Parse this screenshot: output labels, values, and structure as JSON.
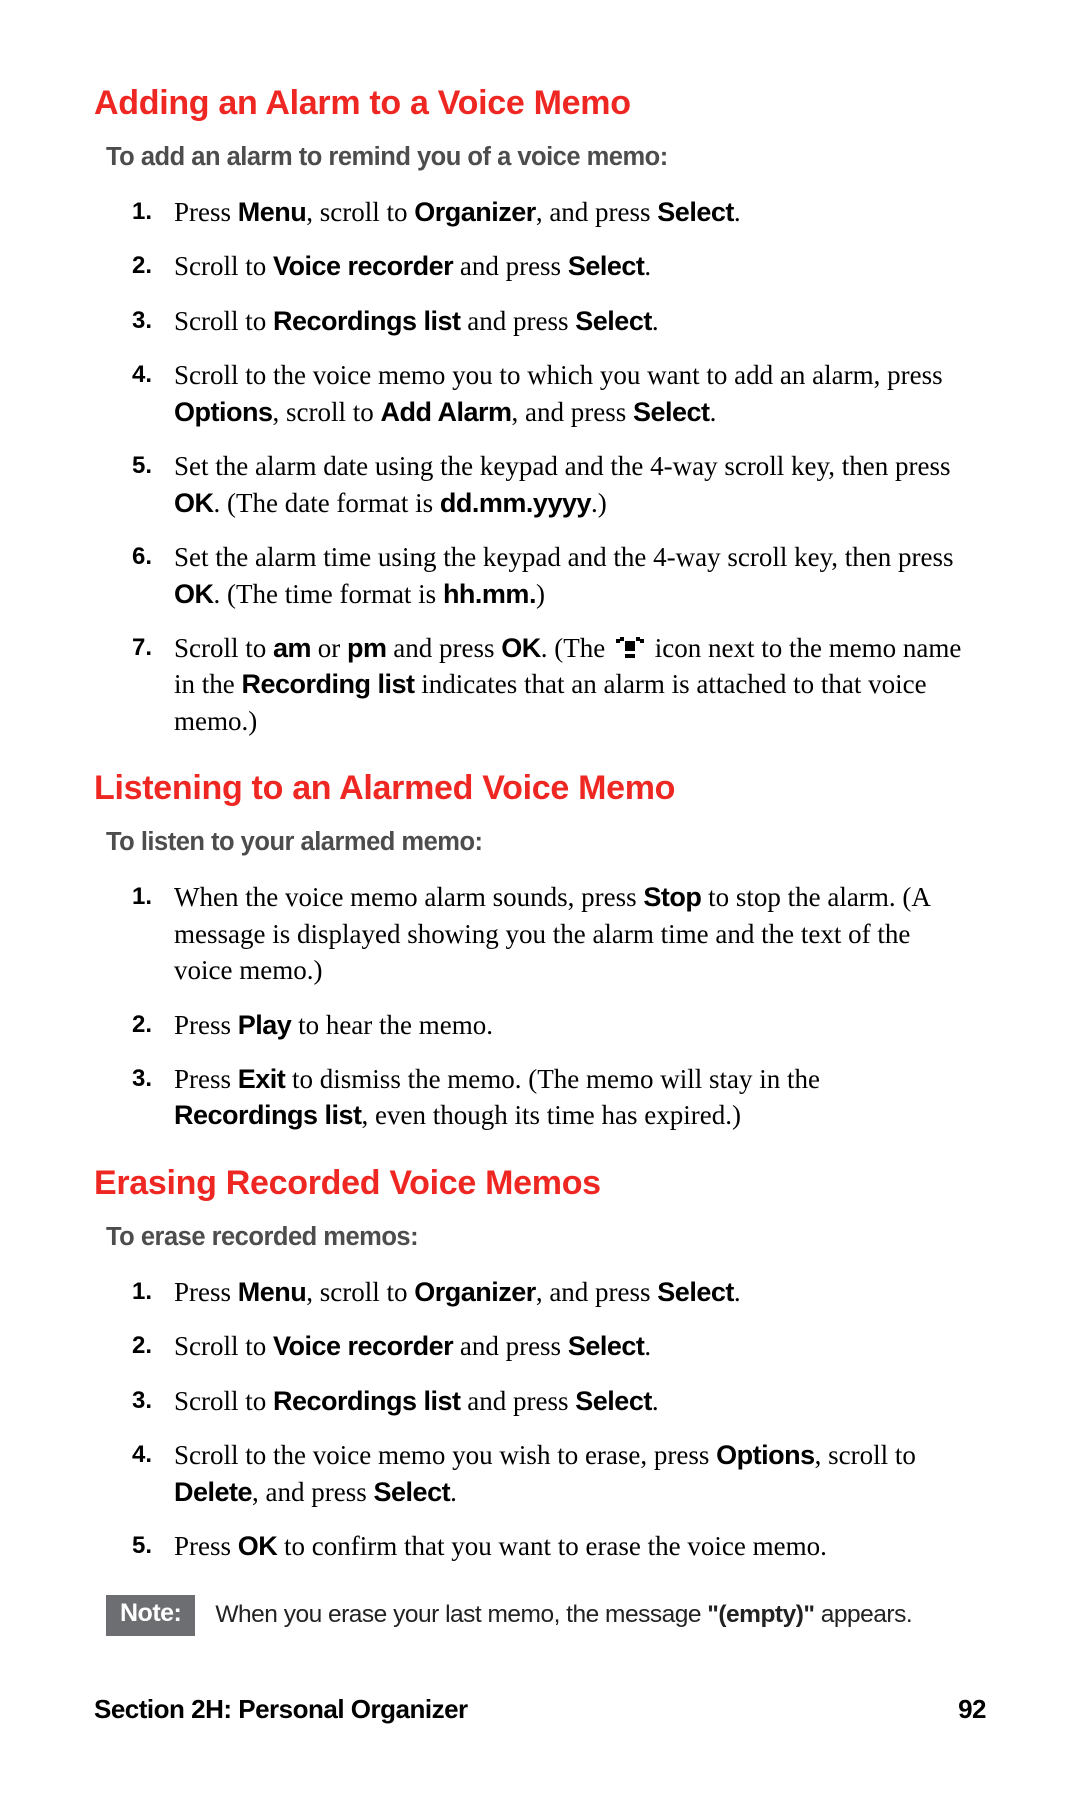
{
  "sections": [
    {
      "heading": "Adding an Alarm to a Voice Memo",
      "intro": "To add an alarm to remind you of a voice memo:",
      "steps": [
        {
          "parts": [
            [
              "t",
              "Press "
            ],
            [
              "b",
              "Menu"
            ],
            [
              "t",
              ", scroll to "
            ],
            [
              "b",
              "Organizer"
            ],
            [
              "t",
              ", and press "
            ],
            [
              "b",
              "Select"
            ],
            [
              "t",
              "."
            ]
          ]
        },
        {
          "parts": [
            [
              "t",
              "Scroll to "
            ],
            [
              "b",
              "Voice recorder"
            ],
            [
              "t",
              " and press "
            ],
            [
              "b",
              "Select"
            ],
            [
              "t",
              "."
            ]
          ]
        },
        {
          "parts": [
            [
              "t",
              "Scroll to "
            ],
            [
              "b",
              "Recordings list"
            ],
            [
              "t",
              " and press "
            ],
            [
              "b",
              "Select"
            ],
            [
              "t",
              "."
            ]
          ]
        },
        {
          "parts": [
            [
              "t",
              "Scroll to the voice memo you to which you want to add an alarm, press "
            ],
            [
              "b",
              "Options"
            ],
            [
              "t",
              ", scroll to "
            ],
            [
              "b",
              "Add Alarm"
            ],
            [
              "t",
              ", and press "
            ],
            [
              "b",
              "Select"
            ],
            [
              "t",
              "."
            ]
          ]
        },
        {
          "parts": [
            [
              "t",
              "Set the alarm date using the keypad and the 4-way scroll key, then press "
            ],
            [
              "b",
              "OK"
            ],
            [
              "t",
              ". (The date format is "
            ],
            [
              "b",
              "dd.mm.yyyy"
            ],
            [
              "t",
              ".)"
            ]
          ]
        },
        {
          "parts": [
            [
              "t",
              "Set the alarm time using the keypad and the 4-way scroll key, then press "
            ],
            [
              "b",
              "OK"
            ],
            [
              "t",
              ". (The time format is "
            ],
            [
              "b",
              "hh.mm."
            ],
            [
              "t",
              ")"
            ]
          ]
        },
        {
          "parts": [
            [
              "t",
              "Scroll to "
            ],
            [
              "b",
              "am"
            ],
            [
              "t",
              " or "
            ],
            [
              "b",
              "pm"
            ],
            [
              "t",
              " and press "
            ],
            [
              "b",
              "OK"
            ],
            [
              "t",
              ". (The "
            ],
            [
              "icon",
              "alarm"
            ],
            [
              "t",
              " icon next to the memo name in the "
            ],
            [
              "b",
              "Recording list"
            ],
            [
              "t",
              " indicates that an alarm is attached to that voice memo.)"
            ]
          ]
        }
      ]
    },
    {
      "heading": "Listening to an Alarmed Voice Memo",
      "intro": "To listen to your alarmed memo:",
      "steps": [
        {
          "parts": [
            [
              "t",
              "When the voice memo alarm sounds, press "
            ],
            [
              "b",
              "Stop"
            ],
            [
              "t",
              " to stop the alarm. (A message is displayed showing you the alarm time and the text of the voice memo.)"
            ]
          ]
        },
        {
          "parts": [
            [
              "t",
              "Press "
            ],
            [
              "b",
              "Play"
            ],
            [
              "t",
              " to hear the memo."
            ]
          ]
        },
        {
          "parts": [
            [
              "t",
              "Press "
            ],
            [
              "b",
              "Exit"
            ],
            [
              "t",
              " to dismiss the memo. (The memo will stay in the "
            ],
            [
              "b",
              "Recordings list"
            ],
            [
              "t",
              ", even though its time has expired.)"
            ]
          ]
        }
      ]
    },
    {
      "heading": "Erasing Recorded Voice Memos",
      "intro": "To erase recorded memos:",
      "steps": [
        {
          "parts": [
            [
              "t",
              "Press "
            ],
            [
              "b",
              "Menu"
            ],
            [
              "t",
              ", scroll to "
            ],
            [
              "b",
              "Organizer"
            ],
            [
              "t",
              ", and press "
            ],
            [
              "b",
              "Select"
            ],
            [
              "t",
              "."
            ]
          ]
        },
        {
          "parts": [
            [
              "t",
              "Scroll to "
            ],
            [
              "b",
              "Voice recorder"
            ],
            [
              "t",
              " and press "
            ],
            [
              "b",
              "Select"
            ],
            [
              "t",
              "."
            ]
          ]
        },
        {
          "parts": [
            [
              "t",
              "Scroll to "
            ],
            [
              "b",
              "Recordings list"
            ],
            [
              "t",
              " and press "
            ],
            [
              "b",
              "Select"
            ],
            [
              "t",
              "."
            ]
          ]
        },
        {
          "parts": [
            [
              "t",
              "Scroll to the voice memo you wish to erase, press "
            ],
            [
              "b",
              "Options"
            ],
            [
              "t",
              ", scroll to "
            ],
            [
              "b",
              "Delete"
            ],
            [
              "t",
              ", and press "
            ],
            [
              "b",
              "Select"
            ],
            [
              "t",
              "."
            ]
          ]
        },
        {
          "parts": [
            [
              "t",
              "Press "
            ],
            [
              "b",
              "OK"
            ],
            [
              "t",
              " to confirm that you want to erase the voice memo."
            ]
          ]
        }
      ]
    }
  ],
  "note": {
    "label": "Note:",
    "body_parts": [
      [
        "t",
        "When you erase your last memo, the message "
      ],
      [
        "b",
        "\"(empty)\""
      ],
      [
        "t",
        " appears."
      ]
    ]
  },
  "footer": {
    "left": "Section 2H: Personal Organizer",
    "right": "92"
  }
}
